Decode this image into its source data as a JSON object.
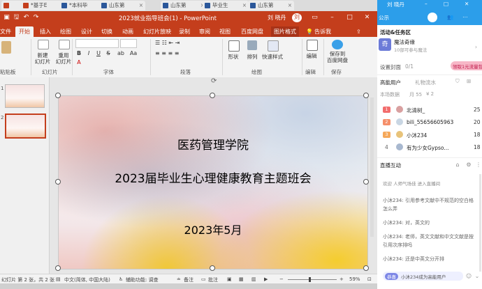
{
  "browser_tabs": [
    {
      "label": "",
      "type": "ppt"
    },
    {
      "label": "*基于E",
      "type": "ppt"
    },
    {
      "label": "*本科毕",
      "type": "word"
    },
    {
      "label": "山东第",
      "type": "word"
    },
    {
      "label": "山东第",
      "type": "word"
    },
    {
      "label": "毕业生",
      "type": "word"
    },
    {
      "label": "山东第",
      "type": "word"
    }
  ],
  "titlebar": {
    "title": "2023就业指导班会(1) - PowerPoint",
    "user": "刘 晓丹"
  },
  "ribbon_tabs": [
    "文件",
    "开始",
    "插入",
    "绘图",
    "设计",
    "切换",
    "动画",
    "幻灯片放映",
    "录制",
    "审阅",
    "视图",
    "百度网盘",
    "图片格式",
    "告诉我"
  ],
  "ribbon": {
    "paste": "粘贴板",
    "new_slide": "新建\n幻灯片",
    "reuse_slide": "重用\n幻灯片",
    "groups": {
      "slides": "幻灯片",
      "font": "字体",
      "paragraph": "段落",
      "drawing": "绘图",
      "editing": "编辑",
      "save": "保存"
    },
    "shape": "形状",
    "arrange": "排列",
    "quick_styles": "快速样式",
    "editing": "编辑",
    "save_baidu": "保存到\n百度网盘",
    "format_buttons": [
      "B",
      "I",
      "U",
      "S",
      "ab",
      "Aa",
      "A"
    ]
  },
  "slide_panel": {
    "thumbs": [
      {
        "num": "1"
      },
      {
        "num": "2"
      }
    ]
  },
  "slide": {
    "line1": "医药管理学院",
    "line2": "2023届毕业生心理健康教育主题班会",
    "line3": "2023年5月"
  },
  "statusbar": {
    "slide_info": "幻灯片 第 2 张，共 2 张",
    "language": "中文(简体, 中国大陆)",
    "accessibility": "辅助功能: 调查",
    "notes": "备注",
    "comments": "批注",
    "zoom": "59%"
  },
  "live_panel": {
    "top_label": "公示",
    "top_user": "刘 晓丹",
    "section_activities": "活动&任务区",
    "activity_title": "魔法奇缘",
    "activity_sub": "10部可参与魔法",
    "cover_label": "设置封面",
    "cover_count": "0/1",
    "claim_button": "领取1元流量包",
    "tab_high_energy": "高能用户",
    "tab_gifts": "礼物流水",
    "this_week": "本场数据",
    "stats": [
      "月 55",
      "¥ 2"
    ],
    "users": [
      {
        "rank": "1",
        "name": "北清树_",
        "score": "25"
      },
      {
        "rank": "2",
        "name": "bili_55656605963",
        "score": "20"
      },
      {
        "rank": "3",
        "name": "小沐234",
        "score": "18"
      },
      {
        "rank": "4",
        "name": "有为少女Gypso...",
        "score": "18"
      }
    ],
    "section_chat": "直播互动",
    "chat": [
      "欢迎 人师气场佳 进入直播间",
      "小沐234: 引用参考文献中不规范的空白格怎么弄",
      "小沐234: 对，英文的",
      "小沐234: 老师，英文文献和中文文献是按引用次序排吗",
      "小沐234: 还是中英文分开排"
    ],
    "bottom_badge": "恭喜",
    "bottom_text": "小沐234成为高能用户"
  },
  "colors": {
    "ppt_red": "#c43e1c",
    "live_blue": "#2c9eea",
    "rank_red": "#f26d6d"
  }
}
